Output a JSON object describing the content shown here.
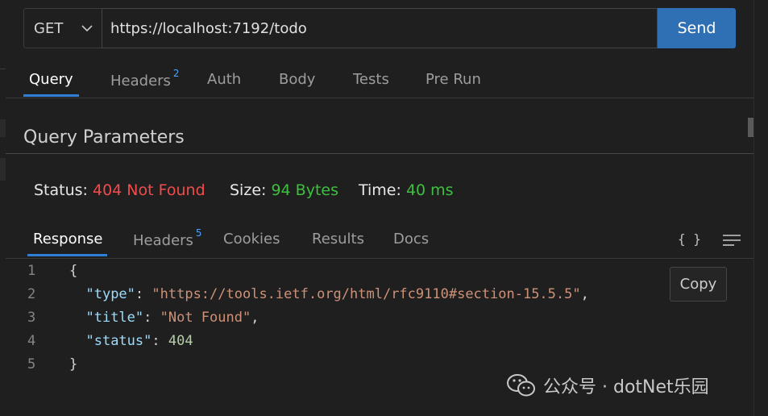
{
  "request": {
    "method": "GET",
    "url": "https://localhost:7192/todo",
    "send_label": "Send"
  },
  "request_tabs": [
    {
      "label": "Query",
      "active": true
    },
    {
      "label": "Headers",
      "badge": "2"
    },
    {
      "label": "Auth"
    },
    {
      "label": "Body"
    },
    {
      "label": "Tests"
    },
    {
      "label": "Pre Run"
    }
  ],
  "query_section": {
    "title": "Query Parameters"
  },
  "status": {
    "status_label": "Status:",
    "status_value": "404 Not Found",
    "size_label": "Size:",
    "size_value": "94 Bytes",
    "time_label": "Time:",
    "time_value": "40 ms"
  },
  "response_tabs": [
    {
      "label": "Response",
      "active": true
    },
    {
      "label": "Headers",
      "badge": "5"
    },
    {
      "label": "Cookies"
    },
    {
      "label": "Results"
    },
    {
      "label": "Docs"
    }
  ],
  "response_icons": {
    "format": "{ }",
    "menu": "menu-icon"
  },
  "code": {
    "line_numbers": [
      "1",
      "2",
      "3",
      "4",
      "5"
    ],
    "open_brace": "{",
    "close_brace": "}",
    "type_key": "\"type\"",
    "type_value": "\"https://tools.ietf.org/html/rfc9110#section-15.5.5\"",
    "title_key": "\"title\"",
    "title_value": "\"Not Found\"",
    "status_key": "\"status\"",
    "status_value": "404",
    "colon": ": ",
    "comma": ","
  },
  "copy_label": "Copy",
  "watermark": {
    "text": "公众号 · dotNet乐园",
    "icon": "wechat-icon"
  },
  "colors": {
    "accent": "#2f6fb3",
    "status_error": "#f14c4c",
    "status_ok": "#3fbf3f",
    "json_key": "#9cdcfe",
    "json_string": "#ce9178",
    "json_number": "#b5cea8"
  }
}
